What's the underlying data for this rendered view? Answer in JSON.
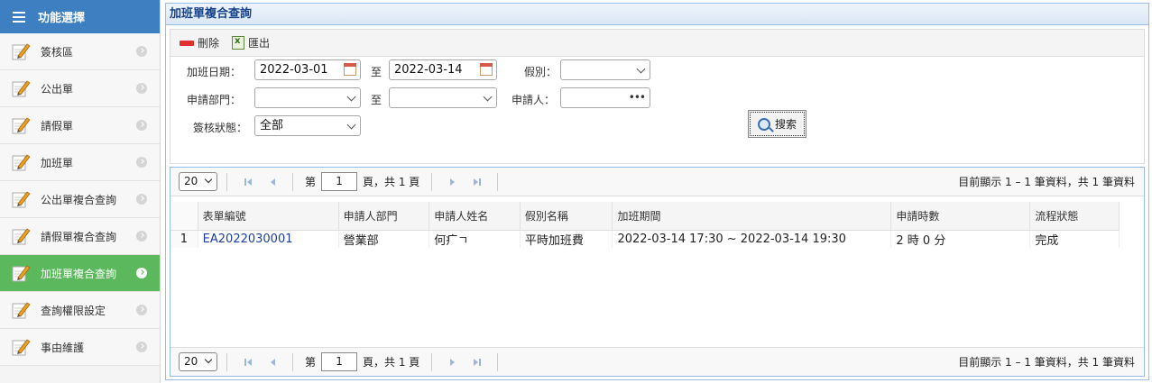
{
  "sidebar": {
    "title": "功能選擇",
    "items": [
      {
        "label": "簽核區"
      },
      {
        "label": "公出單"
      },
      {
        "label": "請假單"
      },
      {
        "label": "加班單"
      },
      {
        "label": "公出單複合查詢"
      },
      {
        "label": "請假單複合查詢"
      },
      {
        "label": "加班單複合查詢",
        "active": true
      },
      {
        "label": "查詢權限設定"
      },
      {
        "label": "事由維護"
      }
    ]
  },
  "main": {
    "title": "加班單複合查詢",
    "toolbar": {
      "delete_label": "刪除",
      "export_label": "匯出"
    }
  },
  "search": {
    "date_label": "加班日期：",
    "date_from": "2022-03-01",
    "to_label": "至",
    "date_to": "2022-03-14",
    "leave_type_label": "假別：",
    "leave_type": "",
    "dept_label": "申請部門：",
    "dept_from": "",
    "dept_to_label": "至",
    "dept_to": "",
    "applicant_label": "申請人：",
    "applicant": "",
    "status_label": "簽核狀態：",
    "status": "全部",
    "search_button": "搜索"
  },
  "pager": {
    "page_size": "20",
    "page_prefix": "第",
    "page": "1",
    "page_suffix": "頁，共 1 頁",
    "info": "目前顯示 1 – 1 筆資料，共 1 筆資料"
  },
  "table": {
    "columns": [
      "表單編號",
      "申請人部門",
      "申請人姓名",
      "假別名稱",
      "加班期間",
      "申請時數",
      "流程狀態"
    ],
    "rows": [
      {
        "num": "1",
        "cells": [
          "EA2022030001",
          "營業部",
          "何疒ㄱ",
          "平時加班費",
          "2022-03-14 17:30 ~ 2022-03-14 19:30",
          "2 時 0 分",
          "完成"
        ]
      }
    ]
  },
  "colors": {
    "accent": "#3d7fc1",
    "active": "#5cb85c",
    "panel_border": "#99bbe8"
  }
}
